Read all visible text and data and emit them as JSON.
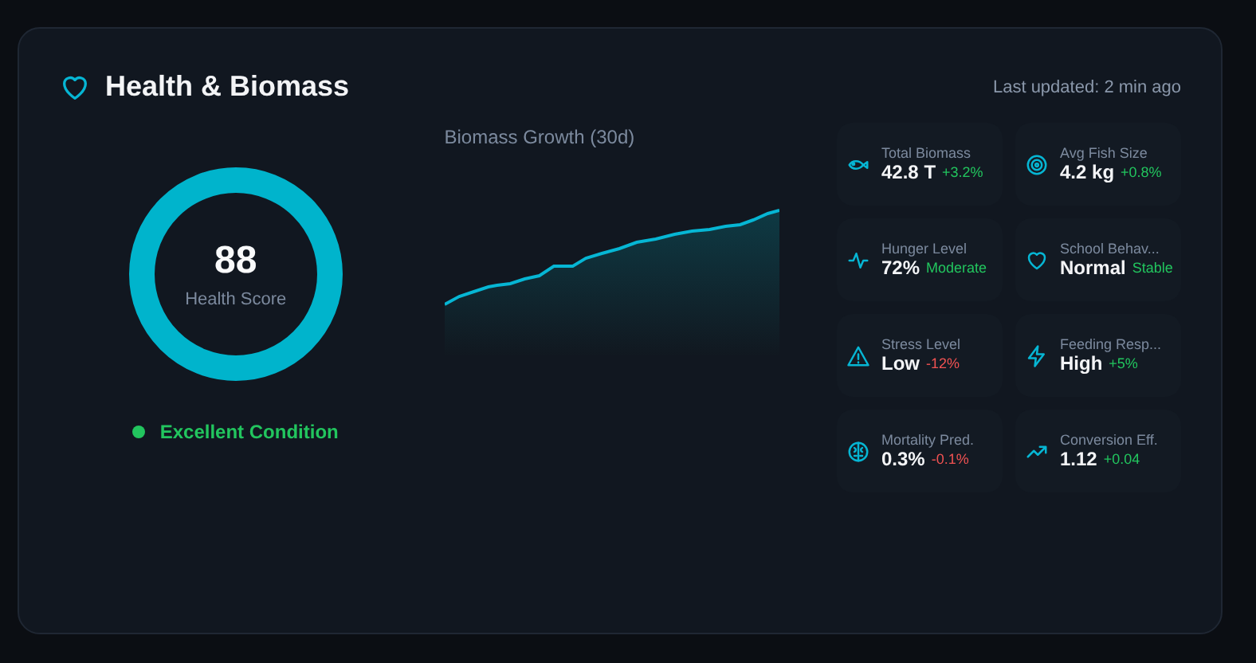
{
  "header": {
    "title": "Health & Biomass",
    "updated": "Last updated: 2 min ago"
  },
  "score": {
    "value": "88",
    "label": "Health Score",
    "status": "Excellent Condition"
  },
  "chart": {
    "title": "Biomass Growth (30d)"
  },
  "metrics": [
    {
      "kind": "fish",
      "label": "Total Biomass",
      "value": "42.8 T",
      "change": "+3.2%",
      "negative": false
    },
    {
      "kind": "target",
      "label": "Avg Fish Size",
      "value": "4.2 kg",
      "change": "+0.8%",
      "negative": false
    },
    {
      "kind": "pulse",
      "label": "Hunger Level",
      "value": "72%",
      "change": "Moderate",
      "negative": false
    },
    {
      "kind": "heart",
      "label": "School Behav...",
      "value": "Normal",
      "change": "Stable",
      "negative": false
    },
    {
      "kind": "warning",
      "label": "Stress Level",
      "value": "Low",
      "change": "-12%",
      "negative": true
    },
    {
      "kind": "bolt",
      "label": "Feeding Resp...",
      "value": "High",
      "change": "+5%",
      "negative": false
    },
    {
      "kind": "brain",
      "label": "Mortality Pred.",
      "value": "0.3%",
      "change": "-0.1%",
      "negative": true
    },
    {
      "kind": "trend",
      "label": "Conversion Eff.",
      "value": "1.12",
      "change": "+0.04",
      "negative": false
    }
  ]
}
